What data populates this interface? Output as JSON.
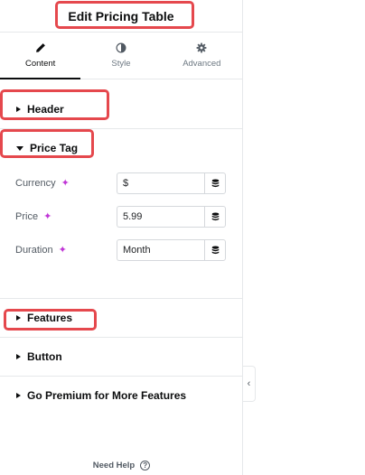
{
  "header": {
    "title": "Edit Pricing Table"
  },
  "tabs": [
    {
      "label": "Content",
      "icon": "pencil-icon",
      "active": true
    },
    {
      "label": "Style",
      "icon": "contrast-icon",
      "active": false
    },
    {
      "label": "Advanced",
      "icon": "gear-icon",
      "active": false
    }
  ],
  "sections": {
    "header": {
      "title": "Header"
    },
    "price_tag": {
      "title": "Price Tag",
      "controls": {
        "currency": {
          "label": "Currency",
          "value": "$"
        },
        "price": {
          "label": "Price",
          "value": "5.99"
        },
        "duration": {
          "label": "Duration",
          "value": "Month"
        }
      }
    },
    "features": {
      "title": "Features"
    },
    "button": {
      "title": "Button"
    },
    "premium": {
      "title": "Go Premium for More Features"
    }
  },
  "footer": {
    "help_label": "Need Help",
    "help_icon_glyph": "?"
  },
  "collapse_glyph": "‹",
  "sparkle_glyph": "✦",
  "colors": {
    "highlight": "#e5484d",
    "ai_accent": "#c036d6",
    "text_dark": "#0c0d0e"
  }
}
